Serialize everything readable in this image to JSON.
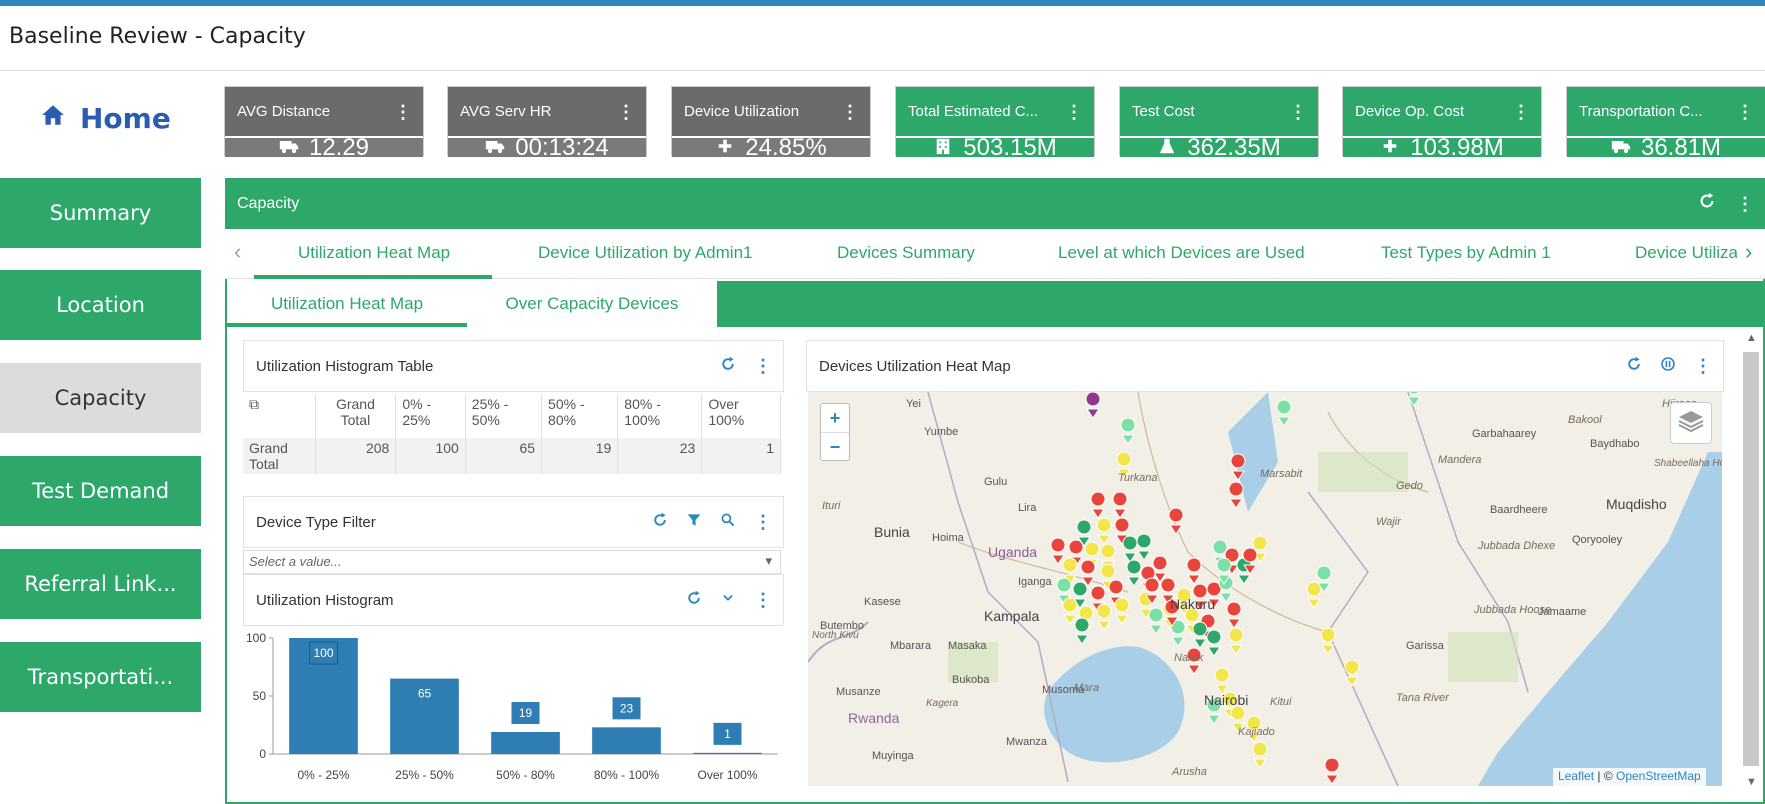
{
  "page": {
    "title": "Baseline Review - Capacity"
  },
  "home": {
    "label": "Home"
  },
  "nav": [
    {
      "label": "Summary"
    },
    {
      "label": "Location"
    },
    {
      "label": "Capacity",
      "active": true
    },
    {
      "label": "Test Demand"
    },
    {
      "label": "Referral Link..."
    },
    {
      "label": "Transportati..."
    }
  ],
  "kpis": [
    {
      "title": "AVG Distance",
      "value": "12.29",
      "icon": "truck-icon",
      "style": "gray"
    },
    {
      "title": "AVG Serv HR",
      "value": "00:13:24",
      "icon": "truck-icon",
      "style": "gray"
    },
    {
      "title": "Device Utilization",
      "value": "24.85%",
      "icon": "plus-icon",
      "style": "gray"
    },
    {
      "title": "Total Estimated C...",
      "value": "503.15M",
      "icon": "building-icon",
      "style": "green"
    },
    {
      "title": "Test Cost",
      "value": "362.35M",
      "icon": "flask-icon",
      "style": "green"
    },
    {
      "title": "Device Op. Cost",
      "value": "103.98M",
      "icon": "plus-icon",
      "style": "green"
    },
    {
      "title": "Transportation C...",
      "value": "36.81M",
      "icon": "truck-icon",
      "style": "green"
    }
  ],
  "panel": {
    "title": "Capacity"
  },
  "tabs_primary": [
    "Utilization Heat Map",
    "Device Utilization by Admin1",
    "Devices Summary",
    "Level at which Devices are Used",
    "Test Types by Admin 1",
    "Device Utilizat"
  ],
  "tabs_secondary": [
    "Utilization Heat Map",
    "Over Capacity Devices"
  ],
  "hist_table": {
    "title": "Utilization Histogram Table",
    "headers": [
      "Grand Total",
      "0% - 25%",
      "25% - 50%",
      "50% - 80%",
      "80% - 100%",
      "Over 100%"
    ],
    "row_label": "Grand Total",
    "values": [
      "208",
      "100",
      "65",
      "19",
      "23",
      "1"
    ]
  },
  "device_filter": {
    "title": "Device Type Filter",
    "placeholder": "Select a value..."
  },
  "histogram": {
    "title": "Utilization Histogram"
  },
  "chart_data": {
    "type": "bar",
    "categories": [
      "0% - 25%",
      "25% - 50%",
      "50% - 80%",
      "80% - 100%",
      "Over 100%"
    ],
    "values": [
      100,
      65,
      19,
      23,
      1
    ],
    "ylim": [
      0,
      100
    ],
    "yticks": [
      0,
      50,
      100
    ],
    "color": "#2e7db3"
  },
  "map": {
    "title": "Devices Utilization Heat Map",
    "zoom_in": "+",
    "zoom_out": "−",
    "attribution_leaflet": "Leaflet",
    "attribution_sep": " | © ",
    "attribution_osm": "OpenStreetMap",
    "labels": [
      "Yei",
      "Yumbe",
      "Gulu",
      "Lira",
      "Ituri",
      "Bunia",
      "Hoima",
      "Uganda",
      "Iganga",
      "Kasese",
      "Kampala",
      "Mbarara",
      "Masaka",
      "Butembo",
      "Bukoba",
      "Musoma",
      "Mwanza",
      "Rwanda",
      "Muyinga",
      "Musanze",
      "Nakuru",
      "Narok",
      "Nairobi",
      "Kitui",
      "Kajiado",
      "Arusha",
      "Garissa",
      "Tana River",
      "Marsabit",
      "Wajir",
      "Mandera",
      "Baydhabo",
      "Muqdisho",
      "Garbahaarey",
      "Baardheere",
      "Qoryooley",
      "Jamaame",
      "Jubbada Hoose",
      "Jubbada Dhexe",
      "Gedo",
      "Bakool",
      "Shabeellaha Hoose",
      "Hiiraan",
      "Turkana",
      "Mara",
      "North Kivu",
      "Kagera"
    ],
    "marker_colors": {
      "red": "#e8453c",
      "green": "#2ea86a",
      "yellow": "#f2e64a",
      "lightgreen": "#7be0a6",
      "purple": "#8e3a8c"
    }
  }
}
